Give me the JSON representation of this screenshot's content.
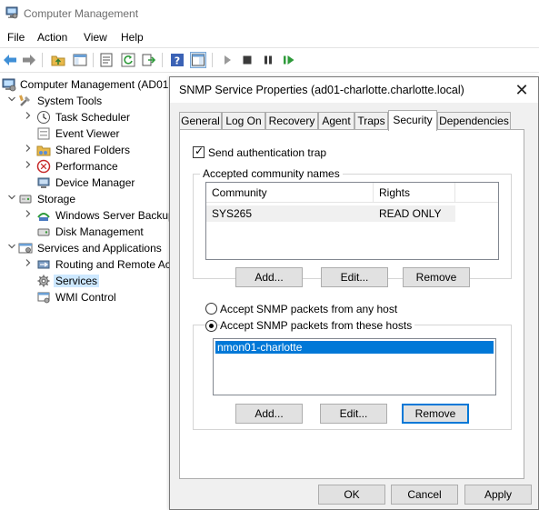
{
  "app": {
    "title": "Computer Management"
  },
  "menu": [
    "File",
    "Action",
    "View",
    "Help"
  ],
  "toolbar": {
    "icons": [
      "back-arrow-icon",
      "forward-arrow-icon",
      "up-folder-icon",
      "show-hide-tree-icon",
      "properties-icon",
      "refresh-icon",
      "export-list-icon",
      "help-icon",
      "show-action-pane-icon",
      "start-service-icon",
      "stop-service-icon",
      "pause-service-icon",
      "resume-service-icon"
    ]
  },
  "tree": {
    "root": "Computer Management (AD01",
    "items": [
      {
        "label": "System Tools"
      },
      {
        "label": "Task Scheduler"
      },
      {
        "label": "Event Viewer"
      },
      {
        "label": "Shared Folders"
      },
      {
        "label": "Performance"
      },
      {
        "label": "Device Manager"
      },
      {
        "label": "Storage"
      },
      {
        "label": "Windows Server Backup"
      },
      {
        "label": "Disk Management"
      },
      {
        "label": "Services and Applications"
      },
      {
        "label": "Routing and Remote Ac"
      },
      {
        "label": "Services"
      },
      {
        "label": "WMI Control"
      }
    ]
  },
  "dialog": {
    "title": "SNMP Service Properties (ad01-charlotte.charlotte.local)",
    "close": "✕",
    "tabs": [
      "General",
      "Log On",
      "Recovery",
      "Agent",
      "Traps",
      "Security",
      "Dependencies"
    ],
    "active_tab": "Security",
    "send_auth_trap": {
      "label": "Send authentication trap",
      "checked": true
    },
    "community_group": {
      "label": "Accepted community names",
      "columns": [
        "Community",
        "Rights"
      ],
      "rows": [
        {
          "community": "SYS265",
          "rights": "READ ONLY"
        }
      ],
      "buttons": {
        "add": "Add...",
        "edit": "Edit...",
        "remove": "Remove"
      }
    },
    "accept_any": {
      "label": "Accept SNMP packets from any host",
      "selected": false
    },
    "accept_these": {
      "label": "Accept SNMP packets from these hosts",
      "selected": true
    },
    "hosts": [
      "nmon01-charlotte"
    ],
    "host_buttons": {
      "add": "Add...",
      "edit": "Edit...",
      "remove": "Remove"
    },
    "footer": {
      "ok": "OK",
      "cancel": "Cancel",
      "apply": "Apply"
    }
  },
  "colors": {
    "selection": "#0078d7",
    "tree_selection": "#cde8ff",
    "dialog_bg": "#f0f0f0"
  }
}
